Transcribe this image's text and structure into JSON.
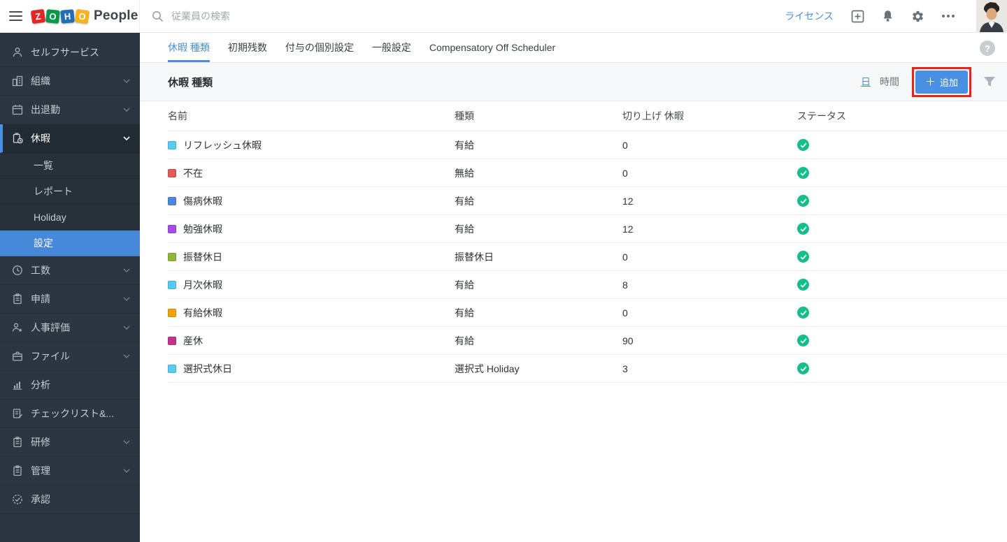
{
  "topbar": {
    "brand": {
      "tiles": [
        {
          "letter": "Z",
          "color": "#E42527"
        },
        {
          "letter": "O",
          "color": "#089949"
        },
        {
          "letter": "H",
          "color": "#226DB4"
        },
        {
          "letter": "O",
          "color": "#F9B21D"
        }
      ],
      "product": "People"
    },
    "search": {
      "placeholder": "従業員の検索"
    },
    "license": "ライセンス"
  },
  "sidebar": {
    "items": [
      {
        "label": "セルフサービス"
      },
      {
        "label": "組織"
      },
      {
        "label": "出退勤"
      },
      {
        "label": "休暇"
      },
      {
        "label": "工数"
      },
      {
        "label": "申請"
      },
      {
        "label": "人事評価"
      },
      {
        "label": "ファイル"
      },
      {
        "label": "分析"
      },
      {
        "label": "チェックリスト&..."
      },
      {
        "label": "研修"
      },
      {
        "label": "管理"
      },
      {
        "label": "承認"
      }
    ],
    "leave_submenu": [
      {
        "label": "一覧"
      },
      {
        "label": "レポート"
      },
      {
        "label": "Holiday"
      },
      {
        "label": "設定"
      }
    ]
  },
  "tabs": [
    {
      "label": "休暇 種類"
    },
    {
      "label": "初期残数"
    },
    {
      "label": "付与の個別設定"
    },
    {
      "label": "一般設定"
    },
    {
      "label": "Compensatory Off Scheduler"
    }
  ],
  "subheader": {
    "title": "休暇 種類",
    "unit_day": "日",
    "unit_time": "時間",
    "add_button": "追加",
    "help": "?"
  },
  "table": {
    "headers": [
      "名前",
      "種類",
      "切り上げ 休暇",
      "ステータス"
    ],
    "rows": [
      {
        "name": "リフレッシュ休暇",
        "color": "#56CCF2",
        "type": "有給",
        "carry": "0",
        "status": "active"
      },
      {
        "name": "不在",
        "color": "#E05C5C",
        "type": "無給",
        "carry": "0",
        "status": "active"
      },
      {
        "name": "傷病休暇",
        "color": "#4E86E0",
        "type": "有給",
        "carry": "12",
        "status": "active"
      },
      {
        "name": "勉強休暇",
        "color": "#A34FE8",
        "type": "有給",
        "carry": "12",
        "status": "active"
      },
      {
        "name": "振替休日",
        "color": "#92B53C",
        "type": "振替休日",
        "carry": "0",
        "status": "active"
      },
      {
        "name": "月次休暇",
        "color": "#56CCF2",
        "type": "有給",
        "carry": "8",
        "status": "active"
      },
      {
        "name": "有給休暇",
        "color": "#F0A30A",
        "type": "有給",
        "carry": "0",
        "status": "active"
      },
      {
        "name": "産休",
        "color": "#C2368A",
        "type": "有給",
        "carry": "90",
        "status": "active"
      },
      {
        "name": "選択式休日",
        "color": "#56CCF2",
        "type": "選択式 Holiday",
        "carry": "3",
        "status": "active"
      }
    ]
  },
  "colors": {
    "accent": "#4A90E2",
    "status_active": "#12BF8C",
    "annotation": "#E8231A"
  }
}
